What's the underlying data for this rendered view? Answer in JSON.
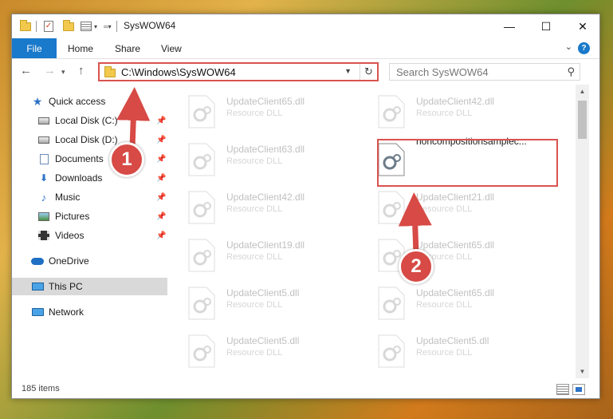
{
  "window": {
    "title": "SysWOW64",
    "min_glyph": "—",
    "max_glyph": "☐",
    "close_glyph": "✕"
  },
  "ribbon": {
    "file": "File",
    "home": "Home",
    "share": "Share",
    "view": "View",
    "help": "?"
  },
  "address": {
    "path": "C:\\Windows\\SysWOW64",
    "search_placeholder": "Search SysWOW64"
  },
  "sidebar": {
    "items": [
      {
        "label": "Quick access"
      },
      {
        "label": "Local Disk (C:)"
      },
      {
        "label": "Local Disk (D:)"
      },
      {
        "label": "Documents"
      },
      {
        "label": "Downloads"
      },
      {
        "label": "Music"
      },
      {
        "label": "Pictures"
      },
      {
        "label": "Videos"
      },
      {
        "label": "OneDrive"
      },
      {
        "label": "This PC"
      },
      {
        "label": "Network"
      }
    ]
  },
  "files": {
    "left": [
      {
        "name": "UpdateClient65.dll",
        "type": "Resource DLL"
      },
      {
        "name": "UpdateClient63.dll",
        "type": "Resource DLL"
      },
      {
        "name": "UpdateClient42.dll",
        "type": "Resource DLL"
      },
      {
        "name": "UpdateClient19.dll",
        "type": "Resource DLL"
      },
      {
        "name": "UpdateClient5.dll",
        "type": "Resource DLL"
      },
      {
        "name": "UpdateClient5.dll",
        "type": "Resource DLL"
      }
    ],
    "right": [
      {
        "name": "UpdateClient42.dll",
        "type": "Resource DLL"
      },
      {
        "name": "noncompositionsamplec...",
        "type": ""
      },
      {
        "name": "UpdateClient21.dll",
        "type": "Resource DLL"
      },
      {
        "name": "UpdateClient65.dll",
        "type": "Resource DLL"
      },
      {
        "name": "UpdateClient65.dll",
        "type": "Resource DLL"
      },
      {
        "name": "UpdateClient5.dll",
        "type": "Resource DLL"
      }
    ]
  },
  "status": {
    "item_count": "185 items"
  },
  "annotations": {
    "step1": "1",
    "step2": "2",
    "accent": "#d9534f"
  }
}
